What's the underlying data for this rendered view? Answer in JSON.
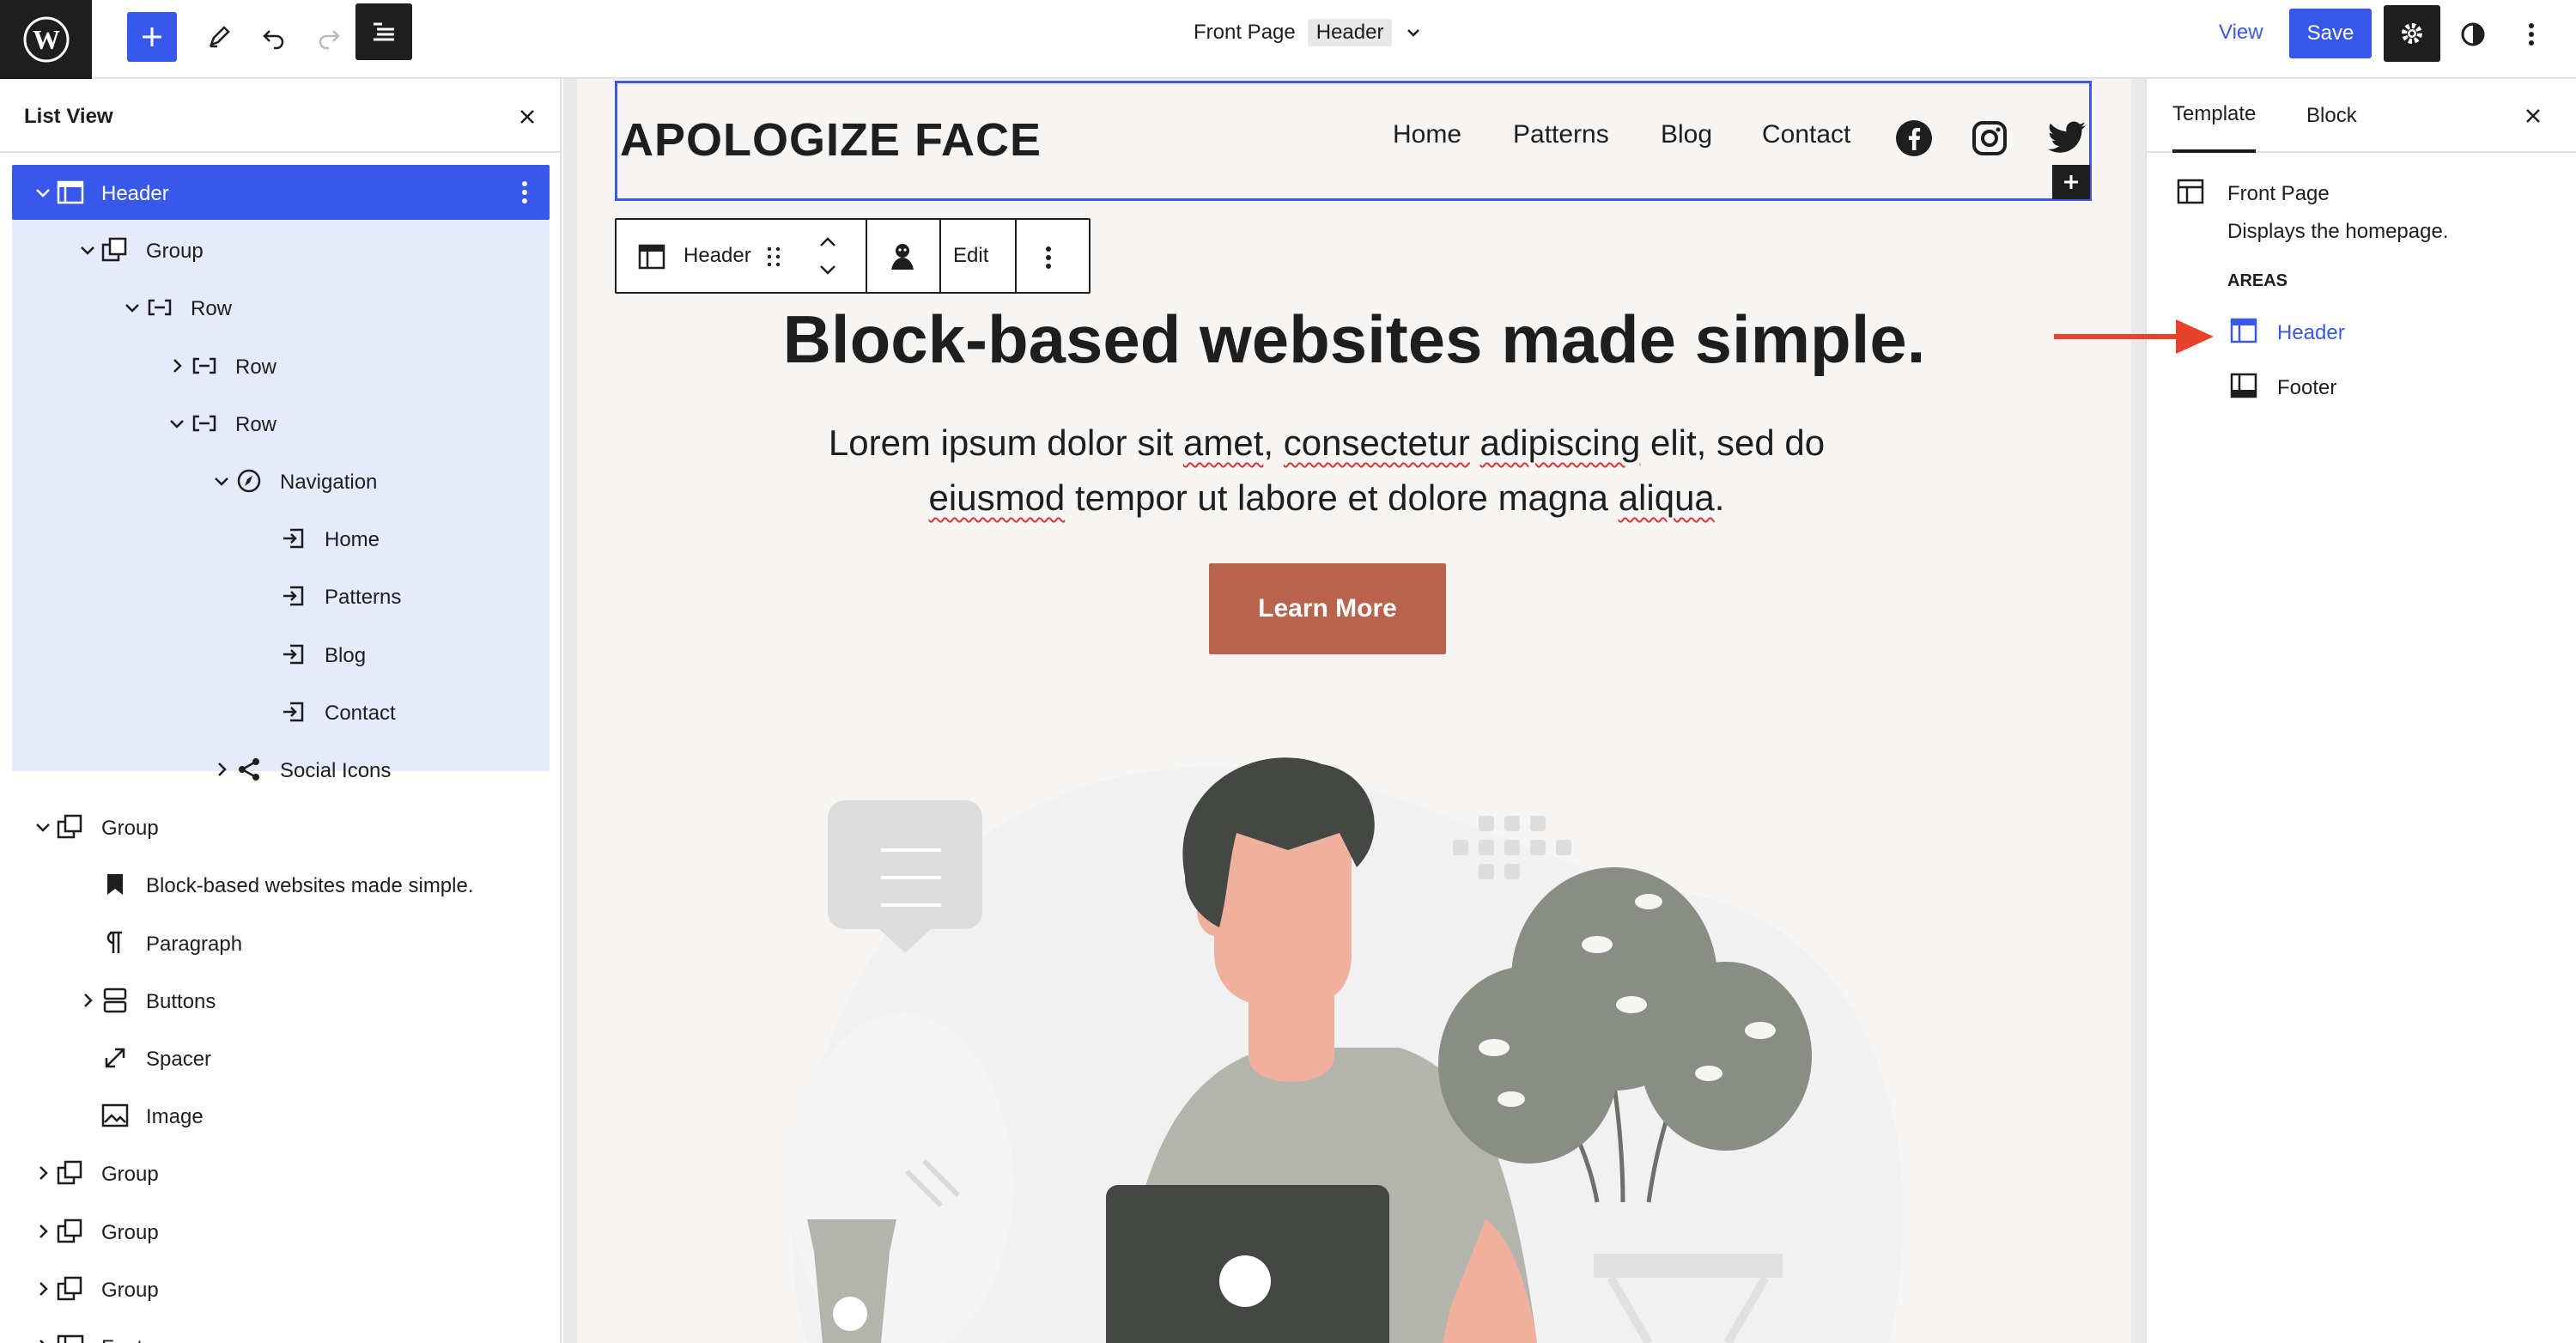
{
  "topbar": {
    "document_title": "Front Page",
    "document_tag": "Header",
    "view_label": "View",
    "save_label": "Save"
  },
  "list_view": {
    "title": "List View",
    "items": [
      {
        "label": "Header"
      },
      {
        "label": "Group"
      },
      {
        "label": "Row"
      },
      {
        "label": "Row"
      },
      {
        "label": "Row"
      },
      {
        "label": "Navigation"
      },
      {
        "label": "Home"
      },
      {
        "label": "Patterns"
      },
      {
        "label": "Blog"
      },
      {
        "label": "Contact"
      },
      {
        "label": "Social Icons"
      },
      {
        "label": "Group"
      },
      {
        "label": "Block-based websites made simple."
      },
      {
        "label": "Paragraph"
      },
      {
        "label": "Buttons"
      },
      {
        "label": "Spacer"
      },
      {
        "label": "Image"
      },
      {
        "label": "Group"
      },
      {
        "label": "Group"
      },
      {
        "label": "Group"
      },
      {
        "label": "Footer"
      }
    ]
  },
  "canvas": {
    "site_title": "APOLOGIZE FACE",
    "nav": [
      "Home",
      "Patterns",
      "Blog",
      "Contact"
    ],
    "block_toolbar": {
      "block_name": "Header",
      "edit_label": "Edit"
    },
    "hero_title": "Block-based websites made simple.",
    "hero_paragraph": {
      "l1_a": "Lorem ipsum dolor sit ",
      "l1_b": "amet",
      "l1_c": ", ",
      "l1_d": "consectetur",
      "l1_e": " ",
      "l1_f": "adipiscing",
      "l1_g": " elit, sed do",
      "l2_a": "eiusmod",
      "l2_b": " tempor ut labore et dolore magna ",
      "l2_c": "aliqua",
      "l2_d": "."
    },
    "button_label": "Learn More"
  },
  "sidebar": {
    "tabs": [
      "Template",
      "Block"
    ],
    "template_name": "Front Page",
    "template_desc": "Displays the homepage.",
    "areas_heading": "AREAS",
    "areas": [
      "Header",
      "Footer"
    ]
  },
  "colors": {
    "accent": "#3858e9",
    "selection_bg": "#e6eafd",
    "button": "#b9634d",
    "annotation_arrow": "#e8412c"
  }
}
